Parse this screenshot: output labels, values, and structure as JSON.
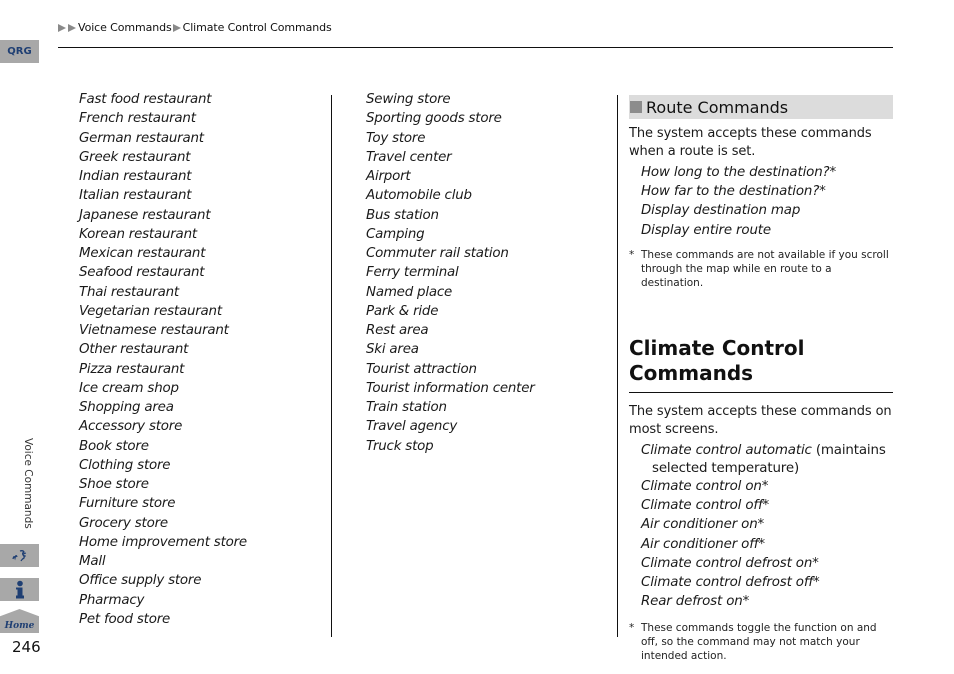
{
  "breadcrumb": {
    "items": [
      "Voice Commands",
      "Climate Control Commands"
    ]
  },
  "sidebar": {
    "qrg_label": "QRG",
    "section_label": "Voice Commands",
    "voice_icon": "voice-command-icon",
    "info_icon": "info-icon",
    "home_label": "Home",
    "page_number": "246"
  },
  "columns": {
    "left": [
      "Fast food restaurant",
      "French restaurant",
      "German restaurant",
      "Greek restaurant",
      "Indian restaurant",
      "Italian restaurant",
      "Japanese restaurant",
      "Korean restaurant",
      "Mexican restaurant",
      "Seafood restaurant",
      "Thai restaurant",
      "Vegetarian restaurant",
      "Vietnamese restaurant",
      "Other restaurant",
      "Pizza restaurant",
      "Ice cream shop",
      "Shopping area",
      "Accessory store",
      "Book store",
      "Clothing store",
      "Shoe store",
      "Furniture store",
      "Grocery store",
      "Home improvement store",
      "Mall",
      "Office supply store",
      "Pharmacy",
      "Pet food store"
    ],
    "middle": [
      "Sewing store",
      "Sporting goods store",
      "Toy store",
      "Travel center",
      "Airport",
      "Automobile club",
      "Bus station",
      "Camping",
      "Commuter rail station",
      "Ferry terminal",
      "Named place",
      "Park & ride",
      "Rest area",
      "Ski area",
      "Tourist attraction",
      "Tourist information center",
      "Train station",
      "Travel agency",
      "Truck stop"
    ]
  },
  "route_commands": {
    "heading": "Route Commands",
    "intro": "The system accepts these commands when a route is set.",
    "commands": [
      "How long to the destination?*",
      "How far to the destination?*",
      "Display destination map",
      "Display entire route"
    ],
    "footnote_star": "*",
    "footnote": "These commands are not available if you scroll through the map while en route to a destination."
  },
  "climate_commands": {
    "title": "Climate Control Commands",
    "intro": "The system accepts these commands on most screens.",
    "first_command": "Climate control automatic",
    "first_note_a": " (maintains",
    "first_note_b": "selected temperature)",
    "commands": [
      "Climate control on*",
      "Climate control off*",
      "Air conditioner on*",
      "Air conditioner off*",
      "Climate control defrost on*",
      "Climate control defrost off*",
      "Rear defrost on*"
    ],
    "footnote_star": "*",
    "footnote": "These commands toggle the function on and off, so the command may not match your intended action."
  }
}
